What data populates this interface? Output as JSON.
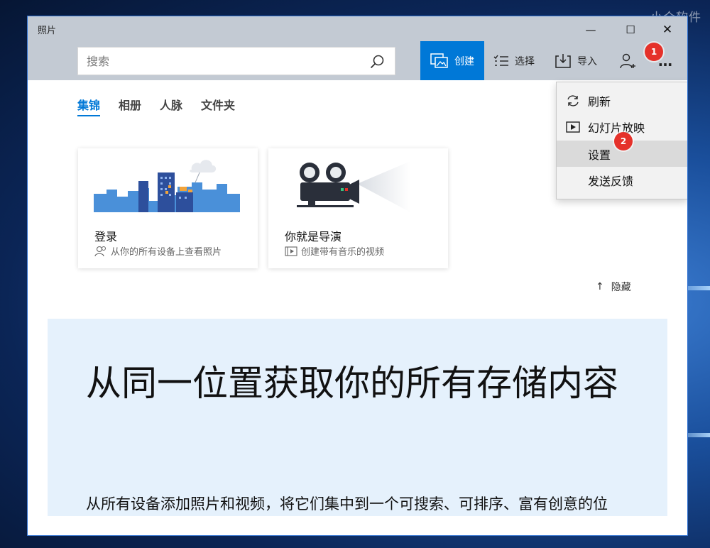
{
  "watermark": "小众软件",
  "window": {
    "title": "照片",
    "minimize": "—",
    "maximize": "☐",
    "close": "✕"
  },
  "search": {
    "placeholder": "搜索"
  },
  "commands": {
    "create": "创建",
    "select": "选择",
    "import": "导入",
    "more": "…"
  },
  "badges": [
    "1",
    "2"
  ],
  "tabs": [
    {
      "label": "集锦",
      "active": true
    },
    {
      "label": "相册",
      "active": false
    },
    {
      "label": "人脉",
      "active": false
    },
    {
      "label": "文件夹",
      "active": false
    }
  ],
  "cards": [
    {
      "title": "登录",
      "subtitle": "从你的所有设备上查看照片",
      "icon": "people-icon"
    },
    {
      "title": "你就是导演",
      "subtitle": "创建带有音乐的视频",
      "icon": "video-icon"
    }
  ],
  "hide_link": {
    "arrow": "↑",
    "label": "隐藏"
  },
  "hero": {
    "title": "从同一位置获取你的所有存储内容",
    "body": "从所有设备添加照片和视频，将它们集中到一个可搜索、可排序、富有创意的位"
  },
  "menu": {
    "items": [
      {
        "label": "刷新",
        "icon": "refresh-icon"
      },
      {
        "label": "幻灯片放映",
        "icon": "slideshow-icon"
      },
      {
        "label": "设置",
        "icon": ""
      },
      {
        "label": "发送反馈",
        "icon": ""
      }
    ]
  },
  "colors": {
    "accent": "#0078d7",
    "titlebar": "#c3cad3",
    "hero_bg": "#e5f1fc",
    "badge": "#e5312a"
  }
}
